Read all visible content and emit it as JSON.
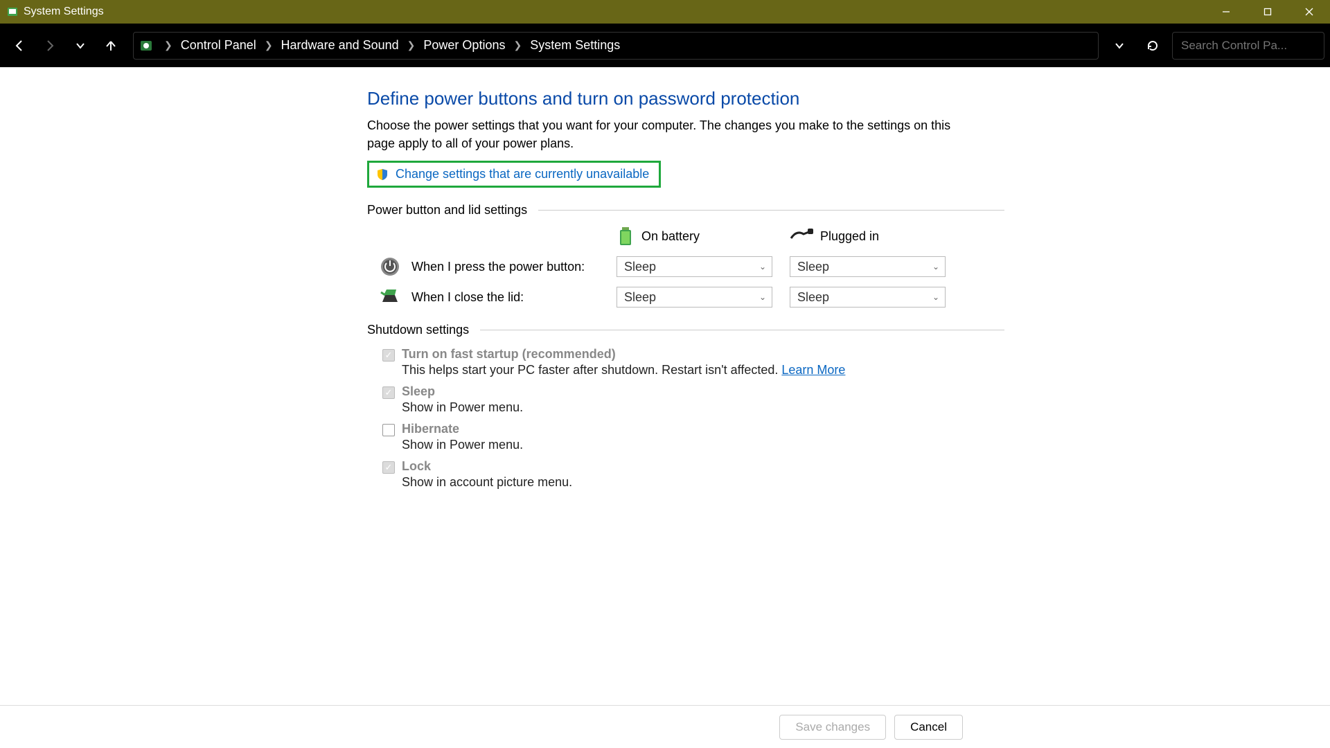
{
  "window": {
    "title": "System Settings"
  },
  "breadcrumb": [
    "Control Panel",
    "Hardware and Sound",
    "Power Options",
    "System Settings"
  ],
  "search": {
    "placeholder": "Search Control Pa..."
  },
  "page": {
    "heading": "Define power buttons and turn on password protection",
    "description": "Choose the power settings that you want for your computer. The changes you make to the settings on this page apply to all of your power plans.",
    "change_link": "Change settings that are currently unavailable"
  },
  "section1": {
    "title": "Power button and lid settings",
    "col_battery": "On battery",
    "col_plugged": "Plugged in",
    "rows": [
      {
        "label": "When I press the power button:",
        "battery": "Sleep",
        "plugged": "Sleep"
      },
      {
        "label": "When I close the lid:",
        "battery": "Sleep",
        "plugged": "Sleep"
      }
    ]
  },
  "section2": {
    "title": "Shutdown settings",
    "items": [
      {
        "title": "Turn on fast startup (recommended)",
        "desc": "This helps start your PC faster after shutdown. Restart isn't affected. ",
        "learn": "Learn More",
        "checked": true
      },
      {
        "title": "Sleep",
        "desc": "Show in Power menu.",
        "checked": true
      },
      {
        "title": "Hibernate",
        "desc": "Show in Power menu.",
        "checked": false
      },
      {
        "title": "Lock",
        "desc": "Show in account picture menu.",
        "checked": true
      }
    ]
  },
  "footer": {
    "save": "Save changes",
    "cancel": "Cancel"
  }
}
